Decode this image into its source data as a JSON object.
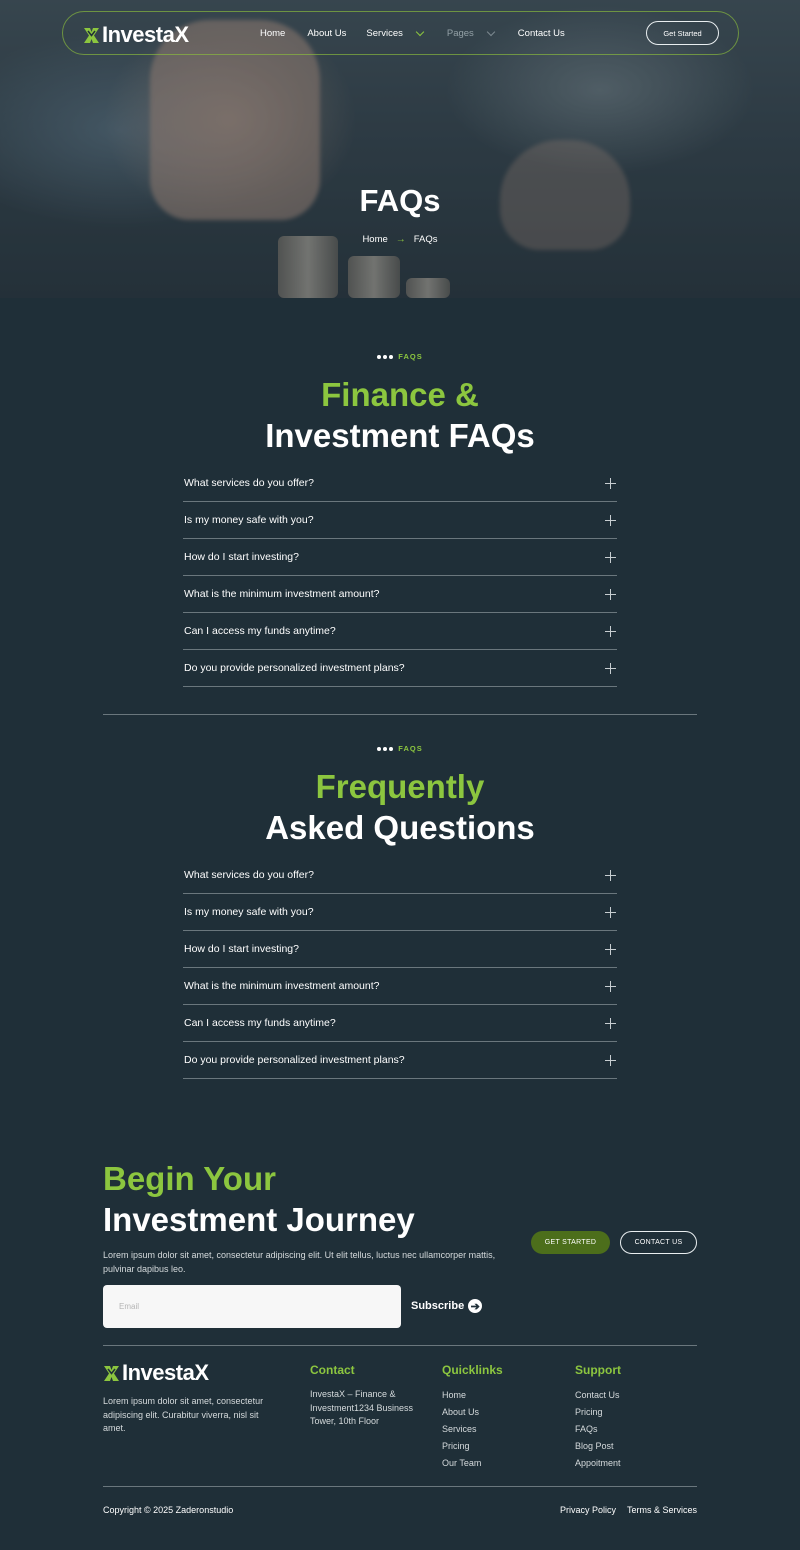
{
  "brand": {
    "name": "InvestaX",
    "accent_color": "#8cc63f"
  },
  "nav": {
    "items": [
      {
        "label": "Home",
        "has_dropdown": false
      },
      {
        "label": "About Us",
        "has_dropdown": false
      },
      {
        "label": "Services",
        "has_dropdown": true
      },
      {
        "label": "Pages",
        "has_dropdown": true
      },
      {
        "label": "Contact Us",
        "has_dropdown": false
      }
    ],
    "cta_label": "Get Started"
  },
  "hero": {
    "title": "FAQs",
    "breadcrumb": {
      "home": "Home",
      "separator": "→",
      "current": "FAQs"
    }
  },
  "faq_section_1": {
    "tag": "FAQS",
    "title_line1": "Finance &",
    "title_line2": "Investment FAQs",
    "questions": [
      "What services do you offer?",
      "Is my money safe with you?",
      "How do I start investing?",
      "What is the minimum investment amount?",
      "Can I access my funds anytime?",
      "Do you provide personalized investment plans?"
    ]
  },
  "faq_section_2": {
    "tag": "FAQS",
    "title_line1": "Frequently",
    "title_line2": "Asked Questions",
    "questions": [
      "What services do you offer?",
      "Is my money safe with you?",
      "How do I start investing?",
      "What is the minimum investment amount?",
      "Can I access my funds anytime?",
      "Do you provide personalized investment plans?"
    ]
  },
  "cta": {
    "title_line1": "Begin Your",
    "title_line2": "Investment Journey",
    "text": "Lorem ipsum dolor sit amet, consectetur adipiscing elit. Ut elit tellus, luctus nec ullamcorper mattis, pulvinar dapibus leo.",
    "primary_button": "GET STARTED",
    "secondary_button": "CONTACT US",
    "email_placeholder": "Email",
    "subscribe_label": "Subscribe"
  },
  "footer": {
    "brand_name": "InvestaX",
    "description": "Lorem ipsum dolor sit amet, consectetur adipiscing elit. Curabitur viverra, nisl sit amet.",
    "contact": {
      "title": "Contact",
      "address": "InvestaX – Finance & Investment1234 Business Tower, 10th Floor"
    },
    "quicklinks": {
      "title": "Quicklinks",
      "items": [
        "Home",
        "About Us",
        "Services",
        "Pricing",
        "Our Team"
      ]
    },
    "support": {
      "title": "Support",
      "items": [
        "Contact Us",
        "Pricing",
        "FAQs",
        "Blog Post",
        "Appoitment"
      ]
    },
    "copyright": "Copyright © 2025 Zaderonstudio",
    "legal": [
      "Privacy Policy",
      "Terms & Services"
    ]
  }
}
